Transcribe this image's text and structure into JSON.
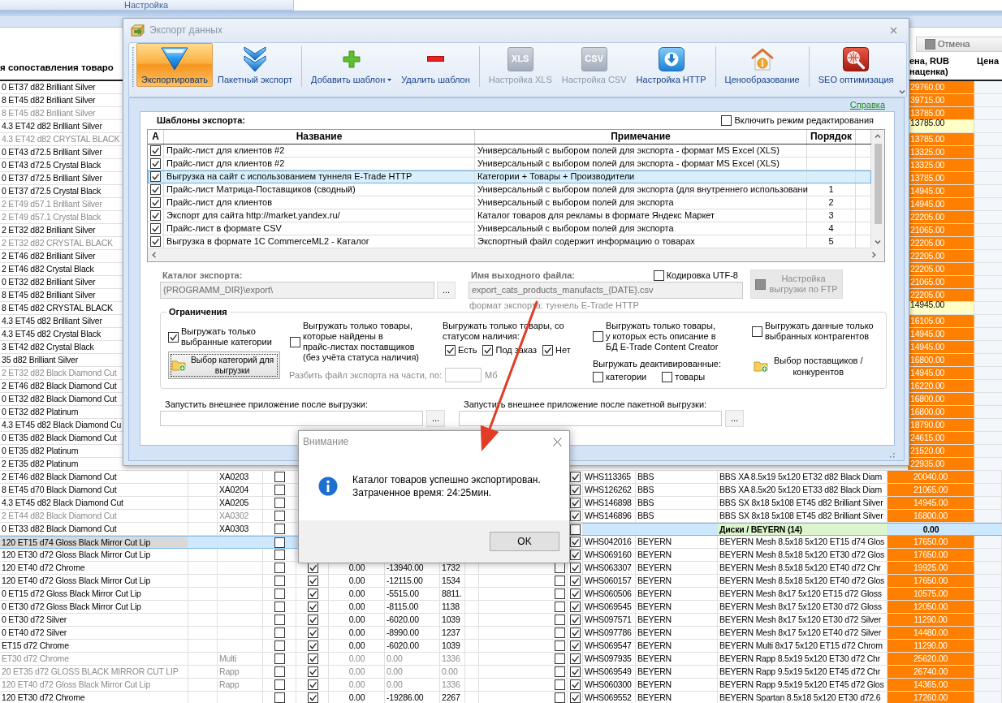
{
  "app": {
    "ribbon_tab": "Настройка",
    "cancel_button": "Отмена",
    "left_table": {
      "columns": [
        "я сопоставления товаро"
      ],
      "rows": [
        {
          "name": "0 ET37 d82 Brilliant Silver",
          "dimmed": false,
          "selected": false
        },
        {
          "name": "8 ET45 d82 Brilliant Silver",
          "dimmed": false,
          "selected": false
        },
        {
          "name": "8 ET45 d82 Brilliant Silver",
          "dimmed": true,
          "selected": false
        },
        {
          "name": "4.3 ET42 d82 Brilliant Silver",
          "dimmed": false,
          "selected": false
        },
        {
          "name": "4.3 ET42 d82 CRYSTAL BLACK",
          "dimmed": true,
          "selected": false
        },
        {
          "name": "0 ET43 d72.5 Brilliant Silver",
          "dimmed": false,
          "selected": false
        },
        {
          "name": "0 ET43 d72.5 Crystal Black",
          "dimmed": false,
          "selected": false
        },
        {
          "name": "0 ET37 d72.5 Brilliant Silver",
          "dimmed": false,
          "selected": false
        },
        {
          "name": "0 ET37 d72.5 Crystal Black",
          "dimmed": false,
          "selected": false
        },
        {
          "name": "2 ET49 d57.1 Brilliant Silver",
          "dimmed": true,
          "selected": false
        },
        {
          "name": "2 ET49 d57.1 Crystal Black",
          "dimmed": true,
          "selected": false
        },
        {
          "name": "2 ET32 d82 Brilliant Silver",
          "dimmed": false,
          "selected": false
        },
        {
          "name": "2 ET32 d82 CRYSTAL BLACK",
          "dimmed": true,
          "selected": false
        },
        {
          "name": "2 ET46 d82 Brilliant Silver",
          "dimmed": false,
          "selected": false
        },
        {
          "name": "2 ET46 d82 Crystal Black",
          "dimmed": false,
          "selected": false
        },
        {
          "name": "0 ET32 d82 Brilliant Silver",
          "dimmed": false,
          "selected": false
        },
        {
          "name": "8 ET45 d82 Brilliant Silver",
          "dimmed": false,
          "selected": false
        },
        {
          "name": "8 ET45 d82 CRYSTAL BLACK",
          "dimmed": false,
          "selected": false
        },
        {
          "name": "4.3 ET45 d82 Brilliant Silver",
          "dimmed": false,
          "selected": false
        },
        {
          "name": "4.3 ET45 d82 Crystal Black",
          "dimmed": false,
          "selected": false
        },
        {
          "name": "3 ET42 d82 Crystal Black",
          "dimmed": false,
          "selected": false
        },
        {
          "name": "35 d82 Brilliant Silver",
          "dimmed": false,
          "selected": false
        },
        {
          "name": "2 ET32 d82 Black Diamond Cut",
          "dimmed": true,
          "selected": false
        },
        {
          "name": "2 ET46 d82 Black Diamond Cut",
          "dimmed": false,
          "selected": false
        },
        {
          "name": "0 ET32 d82 Black Diamond Cut",
          "dimmed": false,
          "selected": false
        },
        {
          "name": "0 ET32 d82 Platinum",
          "dimmed": false,
          "selected": false
        },
        {
          "name": "4.3 ET45 d82 Black Diamond Cu",
          "dimmed": false,
          "selected": false
        },
        {
          "name": "0 ET35 d82 Black Diamond Cut",
          "dimmed": false,
          "selected": false
        },
        {
          "name": "0 ET35 d82 Platinum",
          "dimmed": false,
          "selected": false
        },
        {
          "name": "2 ET35 d82 Platinum",
          "dimmed": false,
          "selected": false
        },
        {
          "name": "2 ET46 d82 Black Diamond Cut",
          "dimmed": false,
          "selected": false,
          "code": "XA0203",
          "check_1": false
        },
        {
          "name": "8 ET45 d70 Black Diamond Cut",
          "dimmed": false,
          "selected": false,
          "code": "XA0204",
          "check_1": false
        },
        {
          "name": "4.3 ET45 d82 Black Diamond Cut",
          "dimmed": false,
          "selected": false,
          "code": "XA0205",
          "check_1": false
        },
        {
          "name": "2 ET44 d82 Black Diamond Cut",
          "dimmed": true,
          "selected": false,
          "code": "XA0302",
          "check_1": false
        },
        {
          "name": "0 ET33 d82 Black Diamond Cut",
          "dimmed": false,
          "selected": false,
          "code": "XA0303",
          "check_1": false
        },
        {
          "name": "120 ET15 d74 Gloss Black Mirror Cut Lip",
          "dimmed": false,
          "selected": true,
          "check_1": false
        },
        {
          "name": "120 ET30 d72 Gloss Black Mirror Cut Lip",
          "dimmed": false,
          "selected": false,
          "check_1": false
        },
        {
          "name": "120 ET40 d72 Chrome",
          "dimmed": false,
          "selected": false,
          "check_1": false,
          "check_2": true,
          "value_1": "0.00",
          "value_2": "-13940.00",
          "value_3": "1732"
        },
        {
          "name": "120 ET40 d72 Gloss Black Mirror Cut Lip",
          "dimmed": false,
          "selected": false,
          "check_1": false,
          "check_2": true,
          "value_1": "0.00",
          "value_2": "-12115.00",
          "value_3": "1534"
        },
        {
          "name": "0 ET15 d72 Gloss Black Mirror Cut Lip",
          "dimmed": false,
          "selected": false,
          "check_1": false,
          "check_2": true,
          "value_1": "0.00",
          "value_2": "-5515.00",
          "value_3": "8811."
        },
        {
          "name": "0 ET30 d72 Gloss Black Mirror Cut Lip",
          "dimmed": false,
          "selected": false,
          "check_1": false,
          "check_2": true,
          "value_1": "0.00",
          "value_2": "-8115.00",
          "value_3": "1138"
        },
        {
          "name": "0 ET30 d72 Silver",
          "dimmed": false,
          "selected": false,
          "check_1": false,
          "check_2": true,
          "value_1": "0.00",
          "value_2": "-6020.00",
          "value_3": "1039"
        },
        {
          "name": "0 ET40 d72 Silver",
          "dimmed": false,
          "selected": false,
          "check_1": false,
          "check_2": true,
          "value_1": "0.00",
          "value_2": "-8990.00",
          "value_3": "1237"
        },
        {
          "name": "ET15 d72 Chrome",
          "dimmed": false,
          "selected": false,
          "check_1": false,
          "check_2": true,
          "value_1": "0.00",
          "value_2": "-6020.00",
          "value_3": "1039"
        },
        {
          "name": "ET30 d72 Chrome",
          "dimmed": true,
          "selected": false,
          "code": "Multi",
          "check_1": false,
          "check_2": true,
          "value_1": "0.00",
          "value_2": "0.00",
          "value_3": "1336"
        },
        {
          "name": "20 ET35 d72 GLOSS BLACK MIRROR CUT LIP",
          "dimmed": true,
          "selected": false,
          "code": "Rapp",
          "check_1": false,
          "check_2": true,
          "value_1": "0.00",
          "value_2": "0.00",
          "value_3": "0.00"
        },
        {
          "name": "120 ET40 d72 Gloss Black Mirror Cut Lip",
          "dimmed": true,
          "selected": false,
          "code": "Rapp",
          "check_1": false,
          "check_2": true,
          "value_1": "0.00",
          "value_2": "0.00",
          "value_3": "1336"
        },
        {
          "name": "120 ET30 d72 Chrome",
          "dimmed": false,
          "selected": false,
          "check_1": false,
          "check_2": true,
          "value_1": "0.00",
          "value_2": "-19286.00",
          "value_3": "2267"
        }
      ]
    },
    "right_table": {
      "columns": [
        "ена, RUB\nнаценка)",
        "Цена"
      ],
      "rows": [
        {
          "kind": "item",
          "price": "29760.00",
          "highlighted": false
        },
        {
          "kind": "item",
          "price": "39715.00",
          "highlighted": false
        },
        {
          "kind": "item",
          "price": "13785.00",
          "highlighted": false
        },
        {
          "kind": "item",
          "price": "13785.00",
          "highlighted": true
        },
        {
          "kind": "item",
          "price": "13785.00",
          "highlighted": false
        },
        {
          "kind": "item",
          "price": "13325.00",
          "highlighted": false
        },
        {
          "kind": "item",
          "price": "13325.00",
          "highlighted": false
        },
        {
          "kind": "item",
          "price": "13785.00",
          "highlighted": false
        },
        {
          "kind": "item",
          "price": "14945.00",
          "highlighted": false
        },
        {
          "kind": "item",
          "price": "14945.00",
          "highlighted": false
        },
        {
          "kind": "item",
          "price": "22205.00",
          "highlighted": false
        },
        {
          "kind": "item",
          "price": "21065.00",
          "highlighted": false
        },
        {
          "kind": "item",
          "price": "22205.00",
          "highlighted": false
        },
        {
          "kind": "item",
          "price": "22205.00",
          "highlighted": false
        },
        {
          "kind": "item",
          "price": "22205.00",
          "highlighted": false
        },
        {
          "kind": "item",
          "price": "21065.00",
          "highlighted": false
        },
        {
          "kind": "item",
          "price": "22205.00",
          "highlighted": false
        },
        {
          "kind": "item",
          "price": "14945.00",
          "highlighted": true
        },
        {
          "kind": "item",
          "price": "16105.00",
          "highlighted": false
        },
        {
          "kind": "item",
          "price": "14945.00",
          "highlighted": false
        },
        {
          "kind": "item",
          "price": "14945.00",
          "highlighted": false
        },
        {
          "kind": "item",
          "price": "16800.00",
          "highlighted": false
        },
        {
          "kind": "item",
          "price": "14945.00",
          "highlighted": false
        },
        {
          "kind": "item",
          "price": "16220.00",
          "highlighted": false
        },
        {
          "kind": "item",
          "price": "16800.00",
          "highlighted": false
        },
        {
          "kind": "item",
          "price": "16800.00",
          "highlighted": false
        },
        {
          "kind": "item",
          "price": "18790.00",
          "highlighted": false
        },
        {
          "kind": "item",
          "price": "24615.00",
          "highlighted": false
        },
        {
          "kind": "item",
          "price": "21520.00",
          "highlighted": false
        },
        {
          "kind": "item",
          "price": "22935.00",
          "highlighted": false
        },
        {
          "kind": "item",
          "check_b": true,
          "code": "WHS113365",
          "brand": "BBS",
          "name": "BBS XA 8.5x19 5x120 ET32 d82 Black Diam",
          "price": "20040.00",
          "highlighted": false
        },
        {
          "kind": "item",
          "check_b": true,
          "code": "WHS126262",
          "brand": "BBS",
          "name": "BBS XA 8.5x20 5x120 ET33 d82 Black Diam",
          "price": "21065.00",
          "highlighted": false
        },
        {
          "kind": "item",
          "check_b": true,
          "code": "WHS146898",
          "brand": "BBS",
          "name": "BBS SX 8x18 5x108 ET45 d82 Brilliant Silver",
          "price": "14945.00",
          "highlighted": false
        },
        {
          "kind": "item",
          "check_b": true,
          "code": "WHS146896",
          "brand": "BBS",
          "name": "BBS SX 8x18 5x108 ET45 d82 Brilliant Silver",
          "price": "16800.00",
          "highlighted": false
        },
        {
          "kind": "group",
          "check_b": false,
          "name": "Диски / BEYERN (14)",
          "price": "0.00"
        },
        {
          "kind": "item",
          "check_b": true,
          "code": "WHS042016",
          "brand": "BEYERN",
          "name": "BEYERN Mesh 8.5x18 5x120 ET15 d74 Glos",
          "price": "17650.00",
          "highlighted": false
        },
        {
          "kind": "item",
          "check_b": true,
          "code": "WHS069160",
          "brand": "BEYERN",
          "name": "BEYERN Mesh 8.5x18 5x120 ET30 d72 Glos",
          "price": "17650.00",
          "highlighted": false
        },
        {
          "kind": "item",
          "check_a": false,
          "check_b": true,
          "code": "WHS063307",
          "brand": "BEYERN",
          "name": "BEYERN Mesh 8.5x18 5x120 ET40 d72 Chr",
          "price": "19925.00",
          "highlighted": false
        },
        {
          "kind": "item",
          "check_a": false,
          "check_b": true,
          "code": "WHS060157",
          "brand": "BEYERN",
          "name": "BEYERN Mesh 8.5x18 5x120 ET40 d72 Glos",
          "price": "17650.00",
          "highlighted": false
        },
        {
          "kind": "item",
          "check_a": false,
          "check_b": true,
          "code": "WHS060506",
          "brand": "BEYERN",
          "name": "BEYERN Mesh 8x17 5x120 ET15 d72 Gloss",
          "price": "10575.00",
          "highlighted": false
        },
        {
          "kind": "item",
          "check_a": false,
          "check_b": true,
          "code": "WHS069545",
          "brand": "BEYERN",
          "name": "BEYERN Mesh 8x17 5x120 ET30 d72 Gloss",
          "price": "12050.00",
          "highlighted": false
        },
        {
          "kind": "item",
          "check_a": false,
          "check_b": true,
          "code": "WHS097571",
          "brand": "BEYERN",
          "name": "BEYERN Mesh 8x17 5x120 ET30 d72 Silver",
          "price": "11290.00",
          "highlighted": false
        },
        {
          "kind": "item",
          "check_a": false,
          "check_b": true,
          "code": "WHS097786",
          "brand": "BEYERN",
          "name": "BEYERN Mesh 8x17 5x120 ET40 d72 Silver",
          "price": "14480.00",
          "highlighted": false
        },
        {
          "kind": "item",
          "check_a": false,
          "check_b": true,
          "code": "WHS069547",
          "brand": "BEYERN",
          "name": "BEYERN Multi 8x17 5x120 ET15 d72 Chrom",
          "price": "11290.00",
          "highlighted": false
        },
        {
          "kind": "item",
          "check_a": false,
          "check_b": true,
          "code": "WHS097935",
          "brand": "BEYERN",
          "name": "BEYERN Rapp 8.5x19 5x120 ET30 d72 Chr",
          "price": "25620.00",
          "highlighted": false
        },
        {
          "kind": "item",
          "check_a": false,
          "check_b": true,
          "code": "WHS069549",
          "brand": "BEYERN",
          "name": "BEYERN Rapp 9.5x19 5x120 ET45 d72 Chr",
          "price": "26740.00",
          "highlighted": false
        },
        {
          "kind": "item",
          "check_a": false,
          "check_b": true,
          "code": "WHS060300",
          "brand": "BEYERN",
          "name": "BEYERN Rapp 9.5x19 5x120 ET45 d72 Glos",
          "price": "14365.00",
          "highlighted": false
        },
        {
          "kind": "item",
          "check_a": false,
          "check_b": true,
          "code": "WHS069552",
          "brand": "BEYERN",
          "name": "BEYERN Spartan 8.5x18 5x120 ET30 d72.6",
          "price": "17260.00",
          "highlighted": false
        }
      ]
    }
  },
  "export_dialog": {
    "title": "Экспорт данных",
    "toolbar_groups": [
      {
        "buttons": [
          {
            "kind": "export",
            "label": "Экспортировать",
            "selected": true,
            "disabled": false,
            "dropdown": false
          },
          {
            "kind": "batch",
            "label": "Пакетный экспорт",
            "selected": false,
            "disabled": false,
            "dropdown": false
          }
        ]
      },
      {
        "buttons": [
          {
            "kind": "add",
            "label": "Добавить шаблон",
            "selected": false,
            "disabled": false,
            "dropdown": true
          },
          {
            "kind": "remove",
            "label": "Удалить шаблон",
            "selected": false,
            "disabled": false,
            "dropdown": false
          }
        ]
      },
      {
        "buttons": [
          {
            "kind": "tile",
            "badge": "XLS",
            "label": "Настройка XLS",
            "selected": false,
            "disabled": true,
            "dropdown": false
          },
          {
            "kind": "tile",
            "badge": "CSV",
            "label": "Настройка CSV",
            "selected": false,
            "disabled": true,
            "dropdown": false
          },
          {
            "kind": "http",
            "label": "Настройка HTTP",
            "selected": false,
            "disabled": false,
            "dropdown": false
          }
        ]
      },
      {
        "buttons": [
          {
            "kind": "pricing",
            "label": "Ценообразование",
            "selected": false,
            "disabled": false,
            "dropdown": false
          }
        ]
      },
      {
        "buttons": [
          {
            "kind": "seo",
            "label": "SEO оптимизация",
            "selected": false,
            "disabled": false,
            "dropdown": false
          }
        ]
      }
    ],
    "help_link": "Справка",
    "templates": {
      "title": "Шаблоны экспорта:",
      "edit_mode": {
        "label": "Включить режим редактирования",
        "checked": false
      },
      "columns": [
        "А",
        "Название",
        "Примечание",
        "Порядок"
      ],
      "rows": [
        {
          "checked": true,
          "name": "Прайс-лист для клиентов #2",
          "note": "Универсальный с выбором полей для экспорта - формат MS Excel (XLS)",
          "selected": false
        },
        {
          "checked": true,
          "name": "Прайс-лист для клиентов #2",
          "note": "Универсальный с выбором полей для экспорта - формат MS Excel (XLS)",
          "selected": false
        },
        {
          "checked": true,
          "name": "Выгрузка на сайт с использованием туннеля E-Trade HTTP",
          "note": "Категории + Товары + Производители",
          "selected": true
        },
        {
          "checked": true,
          "name": "Прайс-лист Матрица-Поставщиков (сводный)",
          "note": "Универсальный с выбором полей для экспорта (для внутреннего использовани",
          "order": "1",
          "selected": false
        },
        {
          "checked": true,
          "name": "Прайс-лист для клиентов",
          "note": "Универсальный с выбором полей для экспорта",
          "order": "2",
          "selected": false
        },
        {
          "checked": true,
          "name": "Экспорт для сайта http://market.yandex.ru/",
          "note": "Каталог товаров для рекламы в формате Яндекс Маркет",
          "order": "3",
          "selected": false
        },
        {
          "checked": true,
          "name": "Прайс-лист в формате CSV",
          "note": "Универсальный с выбором полей для экспорта",
          "order": "4",
          "selected": false
        },
        {
          "checked": true,
          "name": "Выгрузка в формате 1С CommerceML2 - Каталог",
          "note": "Экспортный файл содержит информацию о товарах",
          "order": "5",
          "selected": false
        }
      ]
    },
    "catalog": {
      "label": "Каталог экспорта:",
      "value": "{PROGRAMM_DIR}\\export\\",
      "disabled": true,
      "browse": "..."
    },
    "output_file": {
      "label": "Имя выходного файла:",
      "value": "export_cats_products_manufacts_{DATE}.csv",
      "disabled": true,
      "hint": "формат экспорта: туннель E-Trade HTTP"
    },
    "utf8": {
      "label": "Кодировка UTF-8",
      "checked": false
    },
    "ftp_button": {
      "label": "Настройка\nвыгрузки по FTP",
      "disabled": true
    },
    "restrictions": {
      "title": "Ограничения",
      "selected_categories": {
        "label": "Выгружать только\nвыбранные категории",
        "checked": true
      },
      "categories_button": {
        "label": "Выбор категорий для\nвыгрузки",
        "focused": true
      },
      "supplier_pricelists": {
        "label": "Выгружать только товары,\nкоторые найдены в\nпрайс-листах поставщиков\n(без учёта статуса наличия)",
        "checked": false
      },
      "split_label": "Разбить файл экспорта на части, по:",
      "split_unit": "Мб",
      "stock_label": "Выгружать только товары, со\nстатусом наличия:",
      "stock_options": [
        {
          "label": "Есть",
          "checked": true
        },
        {
          "label": "Под заказ",
          "checked": true
        },
        {
          "label": "Нет",
          "checked": true
        }
      ],
      "with_description": {
        "label": "Выгружать только товары,\nу которых есть описание в\nБД E-Trade Content Creator",
        "checked": false
      },
      "deactivated_label": "Выгружать деактивированные:",
      "deactivated_options": [
        {
          "label": "категории",
          "checked": false
        },
        {
          "label": "товары",
          "checked": false
        }
      ],
      "selected_contractors": {
        "label": "Выгружать данные только\nвыбранных контрагентов",
        "checked": false
      },
      "suppliers_button": "Выбор поставщиков /\nконкурентов"
    },
    "run_after_export": {
      "label": "Запустить внешнее приложение после выгрузки:",
      "browse": "..."
    },
    "run_after_batch": {
      "label": "Запустить внешнее приложение после пакетной выгрузки:",
      "browse": "..."
    }
  },
  "alert_dialog": {
    "title": "Внимание",
    "message_lines": [
      "Каталог товаров успешно экспортирован.",
      "Затраченное время: 24:25мин."
    ],
    "ok_button": "OK"
  }
}
